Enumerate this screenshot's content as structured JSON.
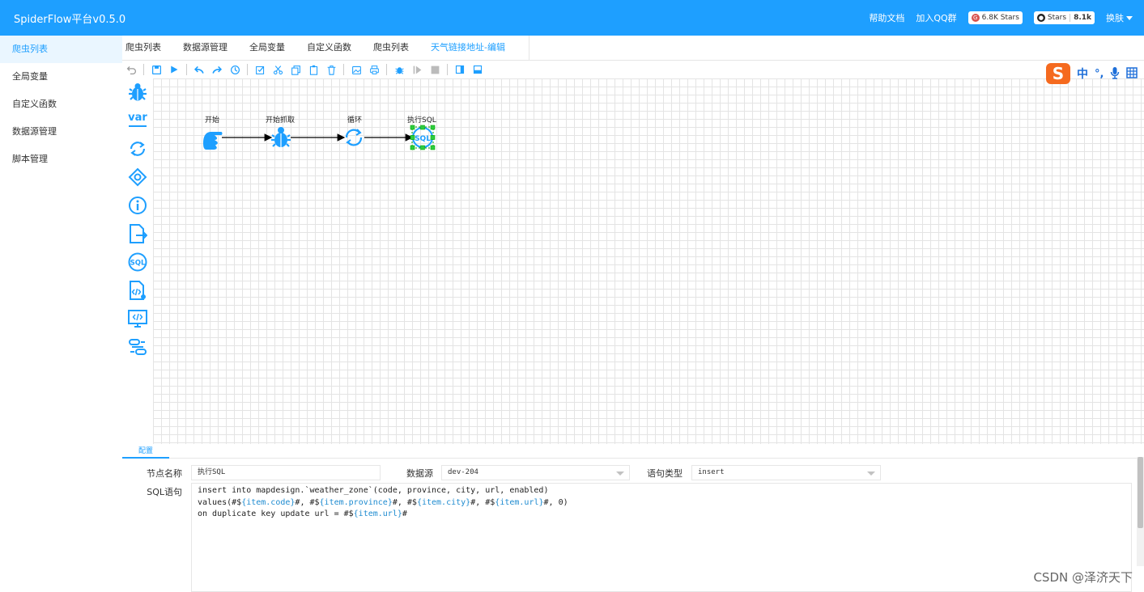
{
  "header": {
    "title": "SpiderFlow平台v0.5.0",
    "help": "帮助文档",
    "qq": "加入QQ群",
    "gitee_stars": "6.8K Stars",
    "github_label": "Stars",
    "github_count": "8.1k",
    "skin": "换肤"
  },
  "sidebar": {
    "items": [
      {
        "label": "爬虫列表",
        "active": true
      },
      {
        "label": "全局变量"
      },
      {
        "label": "自定义函数"
      },
      {
        "label": "数据源管理"
      },
      {
        "label": "脚本管理"
      }
    ]
  },
  "tabs": [
    {
      "label": "爬虫列表"
    },
    {
      "label": "数据源管理"
    },
    {
      "label": "全局变量"
    },
    {
      "label": "自定义函数"
    },
    {
      "label": "爬虫列表"
    },
    {
      "label": "天气链接地址-编辑",
      "active": true
    }
  ],
  "toolbar_icons": [
    "undo-icon",
    "save-icon",
    "run-icon",
    "undo-arrow-icon",
    "redo-arrow-icon",
    "history-icon",
    "select-all-icon",
    "cut-icon",
    "copy-icon",
    "paste-icon",
    "delete-icon",
    "export-image-icon",
    "print-icon",
    "debug-icon",
    "resume-icon",
    "stop-icon",
    "toggle-left-panel-icon",
    "toggle-bottom-panel-icon"
  ],
  "palette_icons": [
    "spider-icon",
    "variable-icon",
    "loop-icon",
    "condition-icon",
    "info-icon",
    "output-icon",
    "sql-icon",
    "function-icon",
    "code-icon",
    "link-icon"
  ],
  "palette_var_label": "var",
  "flow": {
    "nodes": [
      {
        "label": "开始",
        "icon": "hand-pointer-icon"
      },
      {
        "label": "开始抓取",
        "icon": "spider-icon"
      },
      {
        "label": "循环",
        "icon": "loop-icon"
      },
      {
        "label": "执行SQL",
        "icon": "sql-icon"
      }
    ]
  },
  "ime": {
    "logo": "S",
    "mode": "中"
  },
  "config": {
    "tab": "配置",
    "node_name_label": "节点名称",
    "node_name_value": "执行SQL",
    "datasource_label": "数据源",
    "datasource_value": "dev-204",
    "stmt_type_label": "语句类型",
    "stmt_type_value": "insert",
    "sql_label": "SQL语句",
    "sql_lines": {
      "l1": "insert into mapdesign.`weather_zone`(code, province, city, url, enabled)",
      "l2a": "values(#$",
      "l2b": "{item.code}",
      "l2c": "#, #$",
      "l2d": "{item.province}",
      "l2e": "#, #$",
      "l2f": "{item.city}",
      "l2g": "#, #$",
      "l2h": "{item.url}",
      "l2i": "#, 0)",
      "l3a": "on duplicate key update url = #$",
      "l3b": "{item.url}",
      "l3c": "#"
    }
  },
  "watermark": "CSDN @泽济天下",
  "colors": {
    "primary": "#1e9fff",
    "ime_orange": "#f56a1f"
  }
}
